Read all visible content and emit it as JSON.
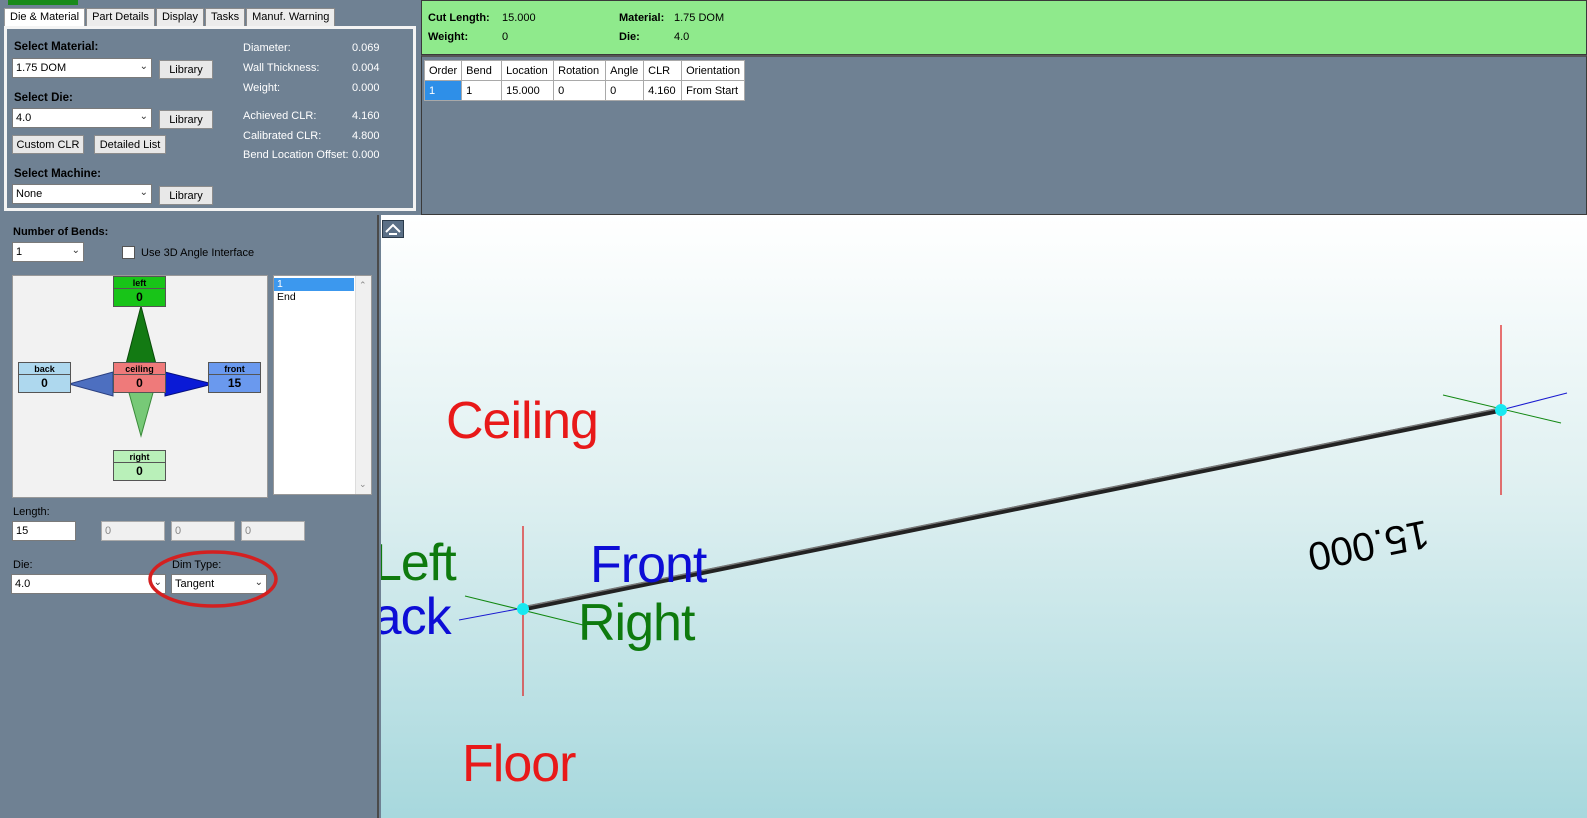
{
  "tabs": [
    "Die & Material",
    "Part Details",
    "Display",
    "Tasks",
    "Manuf. Warning"
  ],
  "material": {
    "select_material_label": "Select Material:",
    "material_value": "1.75 DOM",
    "select_die_label": "Select Die:",
    "die_value": "4.0",
    "select_machine_label": "Select Machine:",
    "machine_value": "None",
    "library_label": "Library",
    "custom_clr_label": "Custom CLR",
    "detailed_list_label": "Detailed List",
    "properties": [
      {
        "label": "Diameter:",
        "value": "0.069"
      },
      {
        "label": "Wall Thickness:",
        "value": "0.004"
      },
      {
        "label": "Weight:",
        "value": "0.000"
      },
      {
        "label": "Achieved CLR:",
        "value": "4.160"
      },
      {
        "label": "Calibrated CLR:",
        "value": "4.800"
      },
      {
        "label": "Bend Location Offset:",
        "value": "0.000"
      }
    ]
  },
  "info": {
    "cut_length_label": "Cut Length:",
    "cut_length_value": "15.000",
    "weight_label": "Weight:",
    "weight_value": "0",
    "material_label": "Material:",
    "material_value": "1.75 DOM",
    "die_label": "Die:",
    "die_value": "4.0"
  },
  "bend_table": {
    "headers": [
      "Order",
      "Bend",
      "Location",
      "Rotation",
      "Angle",
      "CLR",
      "Orientation"
    ],
    "rows": [
      [
        "1",
        "1",
        "15.000",
        "0",
        "0",
        "4.160",
        "From Start"
      ]
    ]
  },
  "bends": {
    "number_label": "Number of Bends:",
    "number_value": "1",
    "use_3d_label": "Use 3D Angle Interface",
    "compass": {
      "left": {
        "label": "left",
        "value": "0"
      },
      "ceiling": {
        "label": "ceiling",
        "value": "0"
      },
      "back": {
        "label": "back",
        "value": "0"
      },
      "front": {
        "label": "front",
        "value": "15"
      },
      "right": {
        "label": "right",
        "value": "0"
      }
    },
    "list": [
      "1",
      "End"
    ],
    "length_label": "Length:",
    "length_value": "15",
    "disabled_values": [
      "0",
      "0",
      "0"
    ],
    "die_label": "Die:",
    "die_value": "4.0",
    "dim_type_label": "Dim Type:",
    "dim_type_value": "Tangent"
  },
  "viewport": {
    "ceiling": "Ceiling",
    "floor": "Floor",
    "left": "Left",
    "back": "Back",
    "front": "Front",
    "right": "Right",
    "dimension": "15.000"
  },
  "colors": {
    "info_bg": "#8fea8c",
    "ceiling_text": "#e81919",
    "front_back_text": "#0d0dd6",
    "left_right_text": "#0e7a0e",
    "node": "#18e8f0",
    "highlight_ellipse": "#d42020"
  }
}
